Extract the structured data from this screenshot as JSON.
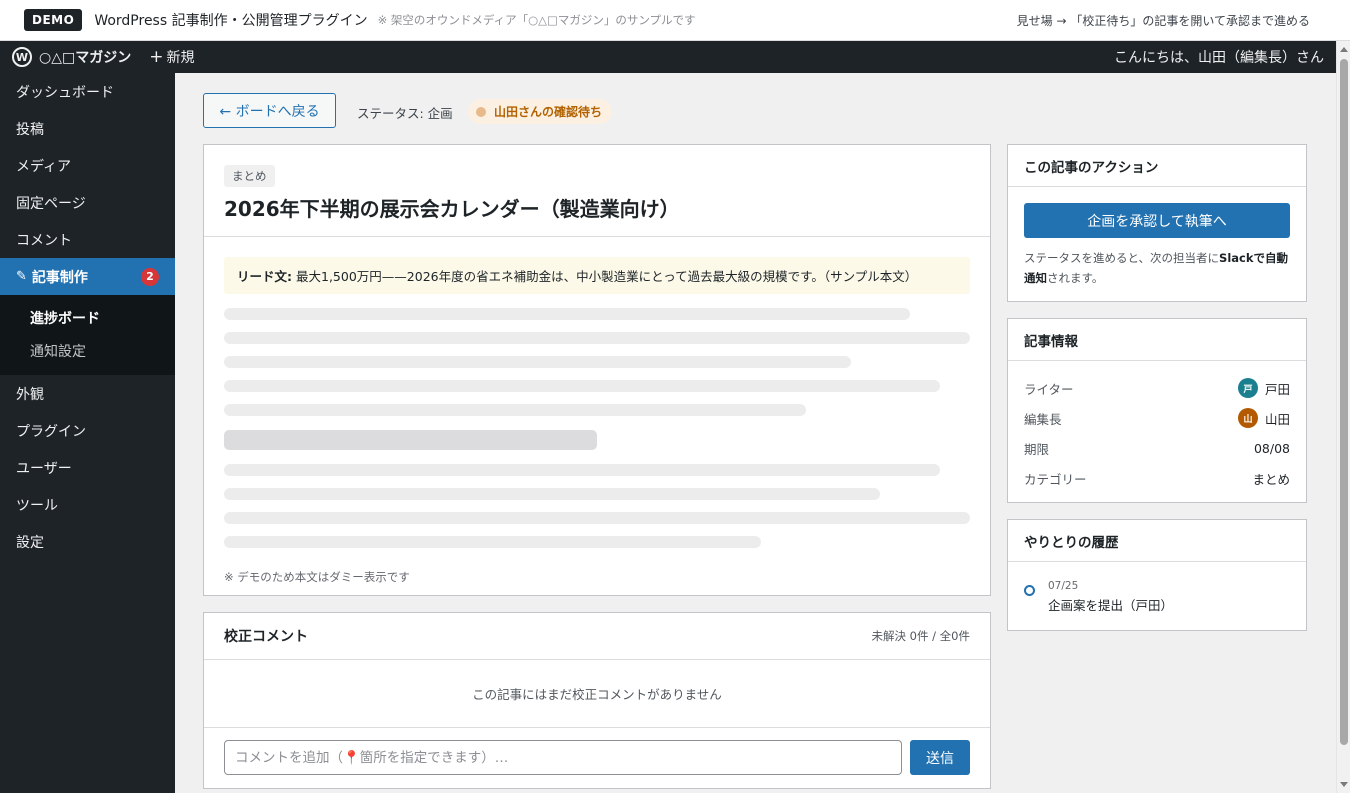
{
  "demo_bar": {
    "badge": "DEMO",
    "title": "WordPress 記事制作・公開管理プラグイン",
    "note": "※ 架空のオウンドメディア「○△□マガジン」のサンプルです",
    "guide": "見せ場 → 「校正待ち」の記事を開いて承認まで進める"
  },
  "admin_bar": {
    "logo": "W",
    "site_name": "○△□マガジン",
    "new_label": "新規",
    "greeting": "こんにちは、山田（編集長）さん"
  },
  "sidebar": {
    "items_top": [
      {
        "label": "ダッシュボード"
      },
      {
        "label": "投稿"
      },
      {
        "label": "メディア"
      },
      {
        "label": "固定ページ"
      },
      {
        "label": "コメント"
      }
    ],
    "active": {
      "label": "記事制作",
      "badge": "2"
    },
    "submenu": [
      {
        "label": "進捗ボード"
      },
      {
        "label": "通知設定"
      }
    ],
    "items_bottom": [
      {
        "label": "外観"
      },
      {
        "label": "プラグイン"
      },
      {
        "label": "ユーザー"
      },
      {
        "label": "ツール"
      },
      {
        "label": "設定"
      }
    ]
  },
  "top": {
    "back_label": "← ボードへ戻る",
    "status_text": "ステータス: 企画",
    "status_pill": "山田さんの確認待ち"
  },
  "article": {
    "category": "まとめ",
    "title": "2026年下半期の展示会カレンダー（製造業向け）",
    "lead_label": "リード文:",
    "lead_text": "最大1,500万円——2026年度の省エネ補助金は、中小製造業にとって過去最大級の規模です。（サンプル本文）",
    "dummy_note": "※ デモのため本文はダミー表示です"
  },
  "comments": {
    "title": "校正コメント",
    "count": "未解決 0件 / 全0件",
    "empty": "この記事にはまだ校正コメントがありません",
    "placeholder": "コメントを追加（📍箇所を指定できます）…",
    "send_label": "送信"
  },
  "actions": {
    "title": "この記事のアクション",
    "primary_label": "企画を承認して執筆へ",
    "desc_before": "ステータスを進めると、次の担当者に",
    "desc_bold": "Slackで自動通知",
    "desc_after": "されます。"
  },
  "info": {
    "title": "記事情報",
    "rows": [
      {
        "key": "ライター",
        "avatar": "戸",
        "avatar_color": "#1a7f8e",
        "value": "戸田"
      },
      {
        "key": "編集長",
        "avatar": "山",
        "avatar_color": "#b35a00",
        "value": "山田"
      },
      {
        "key": "期限",
        "value": "08/08"
      },
      {
        "key": "カテゴリー",
        "value": "まとめ"
      }
    ]
  },
  "history": {
    "title": "やりとりの履歴",
    "items": [
      {
        "date": "07/25",
        "text": "企画案を提出（戸田）"
      }
    ]
  }
}
